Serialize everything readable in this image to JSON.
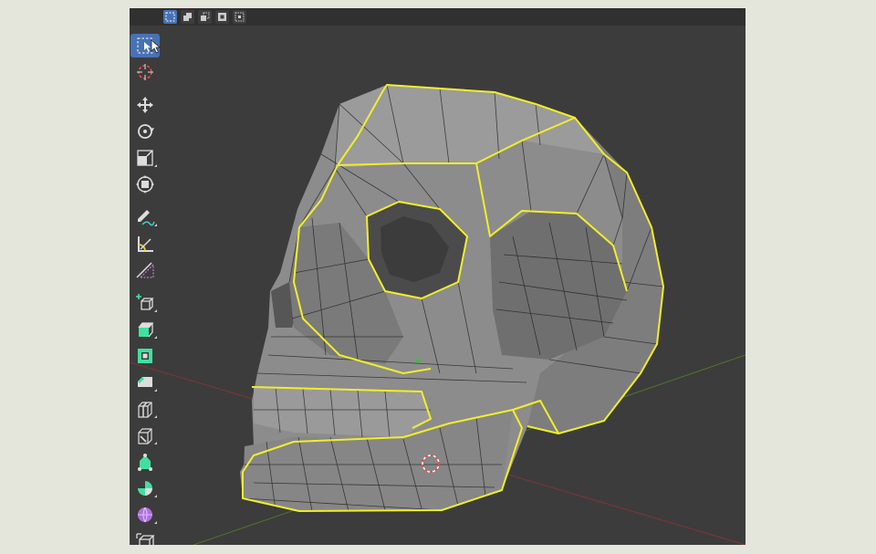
{
  "header": {
    "select_modes": [
      {
        "icon": "select-box-icon",
        "active": true
      },
      {
        "icon": "select-extend-icon",
        "active": false
      },
      {
        "icon": "select-subtract-icon",
        "active": false
      },
      {
        "icon": "select-invert-icon",
        "active": false
      },
      {
        "icon": "select-intersect-icon",
        "active": false
      }
    ]
  },
  "toolbar": {
    "tools": [
      {
        "icon": "select-box-icon",
        "active": true
      },
      {
        "icon": "cursor-icon"
      },
      {
        "icon": "move-icon"
      },
      {
        "icon": "rotate-icon"
      },
      {
        "icon": "scale-icon"
      },
      {
        "icon": "transform-icon"
      },
      {
        "icon": "annotate-icon"
      },
      {
        "icon": "measure-icon"
      },
      {
        "icon": "shear-icon"
      },
      {
        "icon": "add-cube-icon"
      },
      {
        "icon": "extrude-icon"
      },
      {
        "icon": "inset-icon"
      },
      {
        "icon": "bevel-icon"
      },
      {
        "icon": "loop-cut-icon"
      },
      {
        "icon": "knife-icon"
      },
      {
        "icon": "poly-build-icon"
      },
      {
        "icon": "spin-icon"
      },
      {
        "icon": "smooth-icon"
      },
      {
        "icon": "edge-slide-icon"
      }
    ]
  },
  "colors": {
    "viewport_bg": "#3c3c3c",
    "header_bg": "#303030",
    "active_tool": "#4772b3",
    "seam_yellow": "#f2ee2a",
    "mesh_gray": "#8c8c8c",
    "x_axis": "#8a3434",
    "y_axis": "#4f7a2c"
  }
}
